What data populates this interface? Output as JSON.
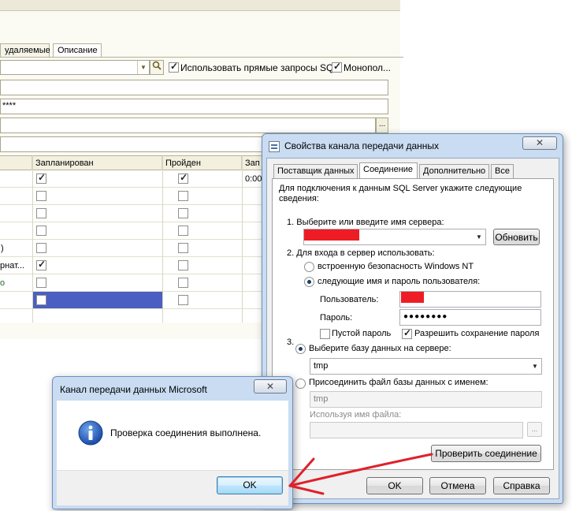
{
  "main_window": {
    "tabs": [
      "удаляемые",
      "Описание"
    ],
    "use_direct_sql_label": "Использовать прямые запросы SQL",
    "use_direct_sql_checked": true,
    "monopoly_label": "Монопол...",
    "monopoly_checked": true,
    "password_mask": "****",
    "ellipsis": "...",
    "grid": {
      "headers": [
        "",
        "Запланирован",
        "Пройден",
        "Зап"
      ],
      "rows": [
        {
          "col1": "",
          "planned": true,
          "passed": true,
          "time": "0:00"
        },
        {
          "col1": "",
          "planned": false,
          "passed": false,
          "time": ""
        },
        {
          "col1": "",
          "planned": false,
          "passed": false,
          "time": ""
        },
        {
          "col1": "",
          "planned": false,
          "passed": false,
          "time": ""
        },
        {
          "col1": ")",
          "planned": false,
          "passed": false,
          "time": ""
        },
        {
          "col1": "рнат...",
          "planned": true,
          "passed": false,
          "time": ""
        },
        {
          "col1": "о",
          "planned": false,
          "passed": false,
          "time": ""
        },
        {
          "col1": "",
          "planned": false,
          "passed": false,
          "time": ""
        }
      ]
    }
  },
  "props_dialog": {
    "title": "Свойства канала передачи данных",
    "close_label": "✕",
    "tabs": [
      "Поставщик данных",
      "Соединение",
      "Дополнительно",
      "Все"
    ],
    "active_tab": "Соединение",
    "intro": "Для подключения к данным SQL Server укажите следующие сведения:",
    "step1_label": "1. Выберите или введите имя сервера:",
    "refresh_button": "Обновить",
    "step2_label": "2. Для входа в сервер использовать:",
    "radio_nt": "встроенную безопасность Windows NT",
    "radio_user": "следующие имя и пароль пользователя:",
    "user_label": "Пользователь:",
    "password_label": "Пароль:",
    "password_value": "●●●●●●●●",
    "empty_password_label": "Пустой пароль",
    "empty_password_checked": false,
    "save_password_label": "Разрешить сохранение пароля",
    "save_password_checked": true,
    "step3_number": "3.",
    "radio_select_db": "Выберите базу данных на сервере:",
    "database_value": "tmp",
    "radio_attach": "Присоединить файл базы данных с именем:",
    "attach_value": "tmp",
    "logical_name_label": "Используя имя файла:",
    "browse_label": "...",
    "test_button": "Проверить соединение",
    "ok_button": "OK",
    "cancel_button": "Отмена",
    "help_button": "Справка"
  },
  "message_box": {
    "title": "Канал передачи данных Microsoft",
    "close_label": "✕",
    "message": "Проверка соединения выполнена.",
    "ok_button": "OK",
    "icon": "info-icon"
  },
  "colors": {
    "redaction": "#ee1c24",
    "arrow": "#e0202a",
    "grid_selection": "#4a5fc1"
  }
}
